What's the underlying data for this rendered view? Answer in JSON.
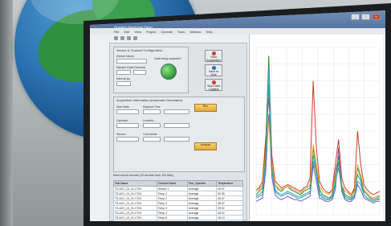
{
  "window": {
    "title": "Quarterly Monitoring Panel",
    "menu": [
      "File",
      "Edit",
      "View",
      "Project",
      "Operate",
      "Tools",
      "Window",
      "Help"
    ],
    "controls": {
      "minimize": "_",
      "maximize": "□",
      "close": "x"
    }
  },
  "panel": {
    "config_group": {
      "title": "Sensor & Channel Configuration",
      "device_label": "Device Name",
      "device_value": "",
      "sample_rate_label": "Sample Rate",
      "sample_rate_value": "",
      "channels_label": "Channels",
      "channels_value": "",
      "interval_label": "Interval (s)",
      "interval_value": "",
      "status_label": "Data being acquired?"
    },
    "buttons": [
      {
        "label": "Start Acquisition",
        "dot_color": "#d23a2a"
      },
      {
        "label": "Save to Disk",
        "dot_color": "#2c6fb5"
      },
      {
        "label": "Stop Data Logging",
        "dot_color": "#d23a2a"
      }
    ],
    "mid_group": {
      "title": "Acquisition Information (Automatic Generated)",
      "fields": [
        {
          "label": "Start Date",
          "value": ""
        },
        {
          "label": "Elapsed Time",
          "value": ""
        },
        {
          "label": "Operator",
          "value": ""
        },
        {
          "label": "Location",
          "value": ""
        },
        {
          "label": "Sensor",
          "value": ""
        },
        {
          "label": "Comments",
          "value": ""
        }
      ],
      "run_label": "Run",
      "analyze_label": "Analyze"
    },
    "table_title": "Most recent records (10 records from 100 files)",
    "table": {
      "headers": [
        "Test Name",
        "Channel Name",
        "Test_Operator",
        "Temperature"
      ],
      "rows": [
        [
          "TS-ACC_01_01-C704",
          "Sensor 1",
          "Average",
          "40.07"
        ],
        [
          "TS-ACC_01_01-C704",
          "Temp 2",
          "Average",
          "50.38"
        ],
        [
          "TS-ACC_01_01-C704",
          "Temp 2",
          "Average",
          "45.07"
        ],
        [
          "TS-ACC_01_01-C704",
          "Temp 3",
          "Average",
          "48.07"
        ],
        [
          "TS-ACC_02_01-C704",
          "Temp 4",
          "Average",
          "49.02"
        ],
        [
          "TS-ACC_02_01-C704",
          "Temp 4",
          "Average",
          "48.02"
        ],
        [
          "TS-ACC_02_01-C704",
          "Temp 5",
          "Average",
          "48.10"
        ],
        [
          "TS-ACC_02_01-C704",
          "Temp 6",
          "Average",
          "49.33"
        ],
        [
          "TS-ACC_02_01-C704",
          "Temp 6",
          "Average",
          "49.07"
        ],
        [
          "TS-ACC_02_01-C704",
          "Temp 6",
          "Average",
          "49.03"
        ]
      ]
    }
  },
  "chart_data": {
    "type": "line",
    "title": "",
    "xlabel": "",
    "ylabel": "",
    "x": [
      0,
      1,
      2,
      3,
      4,
      5,
      6,
      7,
      8,
      9,
      10,
      11,
      12,
      13,
      14,
      15,
      16,
      17,
      18,
      19,
      20,
      21,
      22,
      23,
      24,
      25,
      26,
      27,
      28,
      29,
      30,
      31,
      32,
      33,
      34,
      35,
      36,
      37,
      38,
      39
    ],
    "ylim": [
      0,
      100
    ],
    "series": [
      {
        "color": "#2e8b3a",
        "values": [
          12,
          14,
          16,
          40,
          95,
          30,
          18,
          15,
          14,
          16,
          17,
          15,
          14,
          13,
          12,
          14,
          15,
          16,
          40,
          28,
          15,
          12,
          11,
          10,
          12,
          25,
          35,
          18,
          12,
          11,
          10,
          15,
          28,
          22,
          14,
          12,
          10,
          9,
          10,
          11
        ]
      },
      {
        "color": "#3aa0d8",
        "values": [
          10,
          11,
          12,
          30,
          88,
          28,
          15,
          13,
          12,
          13,
          14,
          13,
          12,
          11,
          11,
          12,
          13,
          14,
          32,
          25,
          13,
          11,
          10,
          9,
          11,
          20,
          28,
          15,
          11,
          10,
          9,
          12,
          20,
          18,
          12,
          10,
          9,
          8,
          9,
          10
        ]
      },
      {
        "color": "#d23a2a",
        "values": [
          15,
          16,
          20,
          45,
          70,
          35,
          20,
          18,
          16,
          17,
          18,
          17,
          16,
          15,
          14,
          16,
          17,
          22,
          80,
          40,
          20,
          16,
          14,
          13,
          15,
          30,
          45,
          22,
          16,
          14,
          12,
          16,
          50,
          30,
          18,
          15,
          13,
          12,
          13,
          14
        ]
      },
      {
        "color": "#7a5ac8",
        "values": [
          8,
          9,
          10,
          25,
          60,
          22,
          12,
          10,
          9,
          10,
          11,
          10,
          9,
          9,
          8,
          9,
          10,
          11,
          30,
          20,
          10,
          9,
          8,
          8,
          9,
          15,
          40,
          14,
          9,
          8,
          8,
          10,
          18,
          15,
          10,
          9,
          8,
          7,
          8,
          8
        ]
      },
      {
        "color": "#e3a426",
        "values": [
          14,
          15,
          18,
          35,
          55,
          30,
          18,
          16,
          15,
          16,
          17,
          16,
          15,
          14,
          13,
          15,
          16,
          18,
          42,
          30,
          17,
          14,
          13,
          12,
          14,
          22,
          30,
          18,
          14,
          13,
          11,
          14,
          30,
          24,
          15,
          13,
          11,
          10,
          11,
          12
        ]
      },
      {
        "color": "#27a39a",
        "values": [
          11,
          12,
          14,
          32,
          78,
          26,
          14,
          12,
          11,
          12,
          13,
          12,
          11,
          10,
          10,
          11,
          12,
          13,
          36,
          24,
          12,
          10,
          9,
          9,
          10,
          18,
          32,
          16,
          10,
          9,
          9,
          11,
          24,
          20,
          12,
          10,
          9,
          8,
          9,
          9
        ]
      }
    ],
    "grid": true
  }
}
